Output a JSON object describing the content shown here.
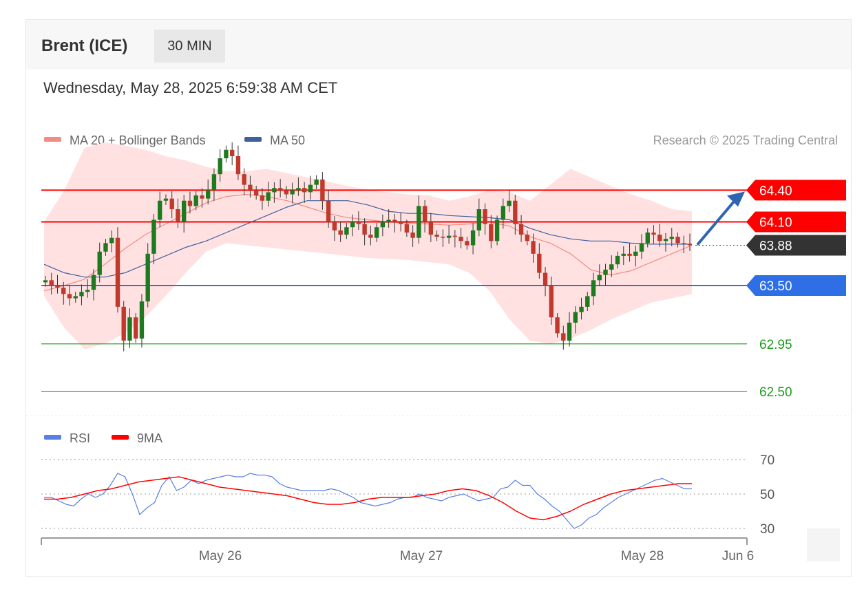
{
  "header": {
    "instrument": "Brent (ICE)",
    "timeframe": "30 MIN",
    "datetime": "Wednesday, May 28, 2025 6:59:38 AM CET"
  },
  "colors": {
    "resistance": "#ff0000",
    "current": "#333333",
    "support_blue": "#2f6fe6",
    "support_green": "#1d9a1d",
    "candle_up": "#1e7a1e",
    "candle_down": "#c0392b",
    "ma20": "#f28b82",
    "band": "#ffe1e1",
    "ma50": "#3f5f9f",
    "rsi": "#5b7fe0",
    "rsi_ma": "#ff0000"
  },
  "chart_data": [
    {
      "type": "candlestick",
      "title": "",
      "legend": [
        {
          "name": "MA 20 + Bollinger Bands",
          "color": "#f28b82"
        },
        {
          "name": "MA 50",
          "color": "#3f5f9f"
        }
      ],
      "credit": "Research © 2025 Trading Central",
      "ylim": [
        62.3,
        64.96
      ],
      "levels": [
        {
          "value": 64.4,
          "label": "64.40",
          "kind": "resistance"
        },
        {
          "value": 64.1,
          "label": "64.10",
          "kind": "resistance"
        },
        {
          "value": 63.88,
          "label": "63.88",
          "kind": "current"
        },
        {
          "value": 63.5,
          "label": "63.50",
          "kind": "support_blue"
        },
        {
          "value": 62.95,
          "label": "62.95",
          "kind": "support_green"
        },
        {
          "value": 62.5,
          "label": "62.50",
          "kind": "support_green"
        }
      ],
      "close_series": [
        63.55,
        63.5,
        63.48,
        63.42,
        63.38,
        63.4,
        63.44,
        63.46,
        63.6,
        63.82,
        63.9,
        63.95,
        63.3,
        62.98,
        63.2,
        63.0,
        63.35,
        63.8,
        64.12,
        64.3,
        64.32,
        64.22,
        64.1,
        64.3,
        64.25,
        64.35,
        64.32,
        64.4,
        64.55,
        64.7,
        64.78,
        64.72,
        64.55,
        64.45,
        64.4,
        64.35,
        64.3,
        64.38,
        64.42,
        64.4,
        64.36,
        64.4,
        64.42,
        64.38,
        64.45,
        64.5,
        64.3,
        64.1,
        64.02,
        63.98,
        64.05,
        64.1,
        64.08,
        63.98,
        63.95,
        64.05,
        64.1,
        64.12,
        64.1,
        64.08,
        64.0,
        63.95,
        64.25,
        64.1,
        63.98,
        63.96,
        63.95,
        63.97,
        63.96,
        63.92,
        63.88,
        64.02,
        64.22,
        64.08,
        63.92,
        64.12,
        64.25,
        64.3,
        64.08,
        63.98,
        63.92,
        63.8,
        63.62,
        63.5,
        63.2,
        63.05,
        62.98,
        63.15,
        63.25,
        63.3,
        63.4,
        63.55,
        63.6,
        63.65,
        63.7,
        63.78,
        63.8,
        63.78,
        63.82,
        63.9,
        64.0,
        63.98,
        63.92,
        63.94,
        63.96,
        63.9,
        63.89,
        63.88
      ],
      "ma20_series": [
        63.45,
        63.5,
        63.56,
        63.7,
        63.85,
        63.98,
        64.08,
        64.18,
        64.28,
        64.34,
        64.36,
        64.34,
        64.3,
        64.24,
        64.18,
        64.14,
        64.12,
        64.1,
        64.09,
        64.08,
        64.07,
        64.08,
        64.1,
        64.06,
        63.96,
        63.9,
        63.8,
        63.65,
        63.6,
        63.64,
        63.72,
        63.8,
        63.88
      ],
      "ma50_series": [
        63.7,
        63.62,
        63.58,
        63.58,
        63.62,
        63.7,
        63.78,
        63.86,
        63.92,
        64.0,
        64.08,
        64.16,
        64.24,
        64.3,
        64.3,
        64.3,
        64.26,
        64.2,
        64.18,
        64.18,
        64.16,
        64.15,
        64.14,
        64.12,
        64.04,
        63.98,
        63.94,
        63.92,
        63.92,
        63.9,
        63.89,
        63.89,
        63.89
      ],
      "band_upper": [
        64.1,
        64.4,
        64.8,
        64.85,
        64.82,
        64.78,
        64.72,
        64.68,
        64.62,
        64.58,
        64.58,
        64.6,
        64.56,
        64.52,
        64.48,
        64.44,
        64.4,
        64.38,
        64.36,
        64.35,
        64.3,
        64.34,
        64.4,
        64.38,
        64.3,
        64.45,
        64.6,
        64.52,
        64.44,
        64.36,
        64.3,
        64.22,
        64.2
      ],
      "band_lower": [
        63.4,
        63.1,
        62.9,
        62.95,
        63.05,
        63.2,
        63.4,
        63.62,
        63.82,
        63.9,
        63.88,
        63.86,
        63.84,
        63.82,
        63.8,
        63.78,
        63.76,
        63.75,
        63.74,
        63.72,
        63.7,
        63.62,
        63.45,
        63.18,
        62.98,
        62.95,
        63.0,
        63.08,
        63.18,
        63.26,
        63.34,
        63.38,
        63.42
      ],
      "x_tick_labels": [
        "May 26",
        "May 27",
        "May 28",
        "Jun 6"
      ]
    },
    {
      "type": "line",
      "title": "",
      "legend": [
        {
          "name": "RSI",
          "color": "#5b7fe0"
        },
        {
          "name": "9MA",
          "color": "#ff0000"
        }
      ],
      "ylim": [
        20,
        80
      ],
      "y_ticks": [
        70,
        50,
        30
      ],
      "series": [
        {
          "name": "RSI",
          "values": [
            48,
            48,
            46,
            44,
            43,
            47,
            50,
            48,
            50,
            55,
            62,
            60,
            50,
            38,
            42,
            45,
            55,
            60,
            52,
            54,
            58,
            56,
            58,
            59,
            60,
            61,
            60,
            60,
            62,
            61,
            61,
            60,
            56,
            54,
            53,
            52,
            52,
            52,
            52,
            53,
            52,
            50,
            48,
            45,
            44,
            43,
            44,
            45,
            47,
            48,
            48,
            50,
            48,
            47,
            46,
            48,
            49,
            50,
            48,
            46,
            47,
            48,
            53,
            54,
            58,
            55,
            55,
            50,
            47,
            43,
            40,
            35,
            30,
            32,
            36,
            38,
            42,
            45,
            48,
            50,
            52,
            54,
            56,
            58,
            59,
            57,
            55,
            53,
            53
          ]
        },
        {
          "name": "9MA",
          "values": [
            47,
            47,
            48,
            50,
            52,
            53,
            55,
            57,
            58,
            59,
            60,
            58,
            56,
            54,
            53,
            52,
            51,
            50,
            49,
            47,
            45,
            44,
            44,
            45,
            47,
            48,
            48,
            48,
            49,
            50,
            52,
            53,
            52,
            49,
            45,
            40,
            36,
            35,
            37,
            40,
            44,
            47,
            50,
            52,
            53,
            54,
            55,
            56,
            56
          ]
        }
      ]
    }
  ]
}
